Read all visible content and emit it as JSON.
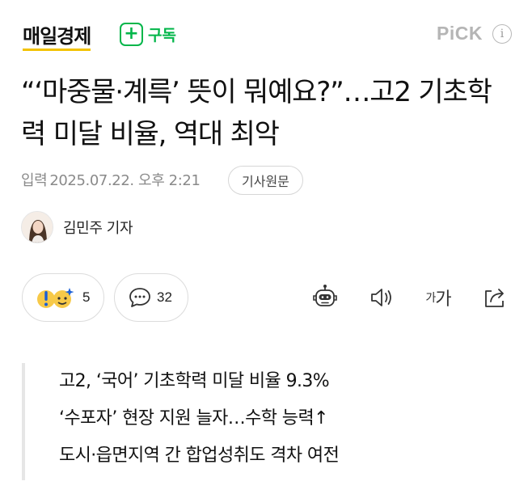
{
  "header": {
    "press_name": "매일경제",
    "subscribe_label": "구독",
    "subscribe_icon": "plus-icon",
    "pick_label": "PiCK",
    "pick_info_icon": "info-icon",
    "accent_color": "#03b64a",
    "logo_underline_color": "#f2c200"
  },
  "article": {
    "headline": "“‘마중물·계륵’ 뜻이 뭐예요?”…고2 기초학력 미달 비율, 역대 최악",
    "date_prefix": "입력",
    "date": "2025.07.22. 오후 2:21",
    "original_button_label": "기사원문",
    "reporter_name": "김민주 기자",
    "reporter_avatar_icon": "reporter-photo"
  },
  "actions": {
    "reaction_count": "5",
    "reaction_icon": "reaction-emoji-icon",
    "comment_count": "32",
    "comment_icon": "speech-bubble-icon",
    "summary_bot_icon": "robot-icon",
    "tts_icon": "speaker-icon",
    "font_size_label_small": "가",
    "font_size_label_large": "가",
    "share_icon": "share-icon"
  },
  "summary": {
    "lines": [
      "고2, ‘국어’ 기초학력 미달 비율 9.3%",
      "‘수포자’ 현장 지원 늘자…수학 능력↑",
      "도시·읍면지역 간 합업성취도 격차 여전"
    ]
  }
}
